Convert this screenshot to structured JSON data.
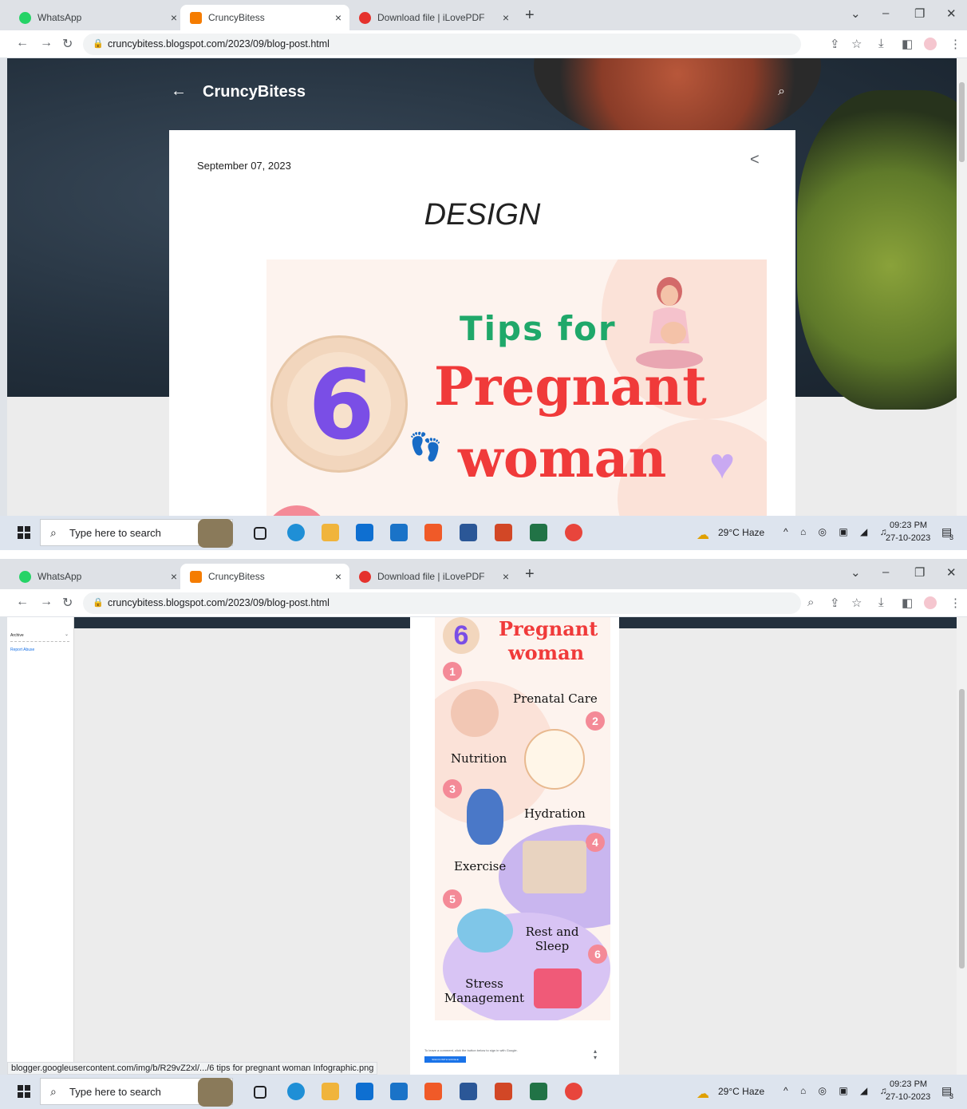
{
  "screens": [
    {
      "tabs": [
        {
          "label": "WhatsApp"
        },
        {
          "label": "CruncyBitess"
        },
        {
          "label": "Download file | iLovePDF"
        }
      ],
      "url": "cruncybitess.blogspot.com/2023/09/blog-post.html",
      "blog": {
        "title": "CruncyBitess",
        "post_date": "September 07, 2023",
        "post_title": "DESIGN"
      },
      "infographic": {
        "number": "6",
        "line1": "Tips for",
        "line2": "Pregnant",
        "line3": "woman"
      }
    },
    {
      "tabs": [
        {
          "label": "WhatsApp"
        },
        {
          "label": "CruncyBitess"
        },
        {
          "label": "Download file | iLovePDF"
        }
      ],
      "url": "cruncybitess.blogspot.com/2023/09/blog-post.html",
      "sidebar": {
        "archive_label": "Archive",
        "report_link": "Report Abuse"
      },
      "infographic": {
        "number": "6",
        "line2": "Pregnant",
        "line3": "woman",
        "tips": [
          {
            "num": "1",
            "label": "Prenatal Care"
          },
          {
            "num": "2",
            "label": "Nutrition"
          },
          {
            "num": "3",
            "label": "Hydration"
          },
          {
            "num": "4",
            "label": "Exercise"
          },
          {
            "num": "5",
            "label": "Rest and Sleep"
          },
          {
            "num": "6",
            "label": "Stress Management"
          }
        ]
      },
      "comments": {
        "prompt": "To leave a comment, click the button below to sign in with Google.",
        "button": "SIGN IN WITH GOOGLE"
      },
      "status_url": "blogger.googleusercontent.com/img/b/R29vZ2xl/.../6 tips for pregnant woman Infographic.png"
    }
  ],
  "taskbar": {
    "search_placeholder": "Type here to search",
    "weather": "29°C  Haze",
    "time": "09:23 PM",
    "date": "27-10-2023",
    "notifications": "3"
  },
  "colors": {
    "tab_strip": "#dee1e6",
    "hero_dark": "#24313e",
    "title_red": "#f03a3a",
    "tips_green": "#1fa86a",
    "six_purple": "#7a4ee6",
    "badge_pink": "#f48a97"
  }
}
